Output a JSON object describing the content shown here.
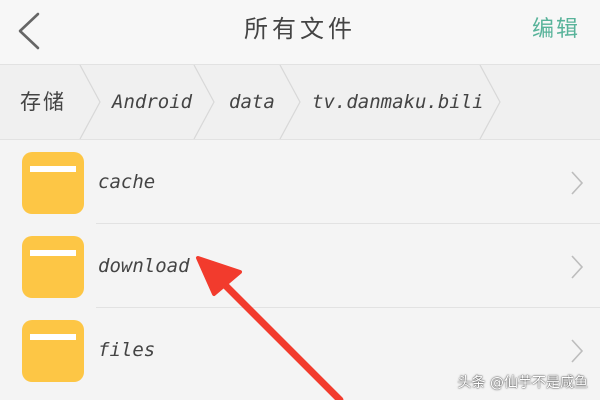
{
  "header": {
    "title": "所有文件",
    "back_icon": "chevron-left-icon",
    "edit_label": "编辑",
    "edit_color": "#58b39a"
  },
  "breadcrumb": {
    "items": [
      {
        "label": "存储"
      },
      {
        "label": "Android"
      },
      {
        "label": "data"
      },
      {
        "label": "tv.danmaku.bili"
      }
    ]
  },
  "file_list": {
    "folder_color": "#fdc645",
    "items": [
      {
        "name": "cache",
        "icon": "folder-icon"
      },
      {
        "name": "download",
        "icon": "folder-icon"
      },
      {
        "name": "files",
        "icon": "folder-icon"
      }
    ]
  },
  "annotation": {
    "arrow_color": "#f23b2d"
  },
  "watermark": {
    "text": "头条 @仙芋不是咸鱼"
  }
}
